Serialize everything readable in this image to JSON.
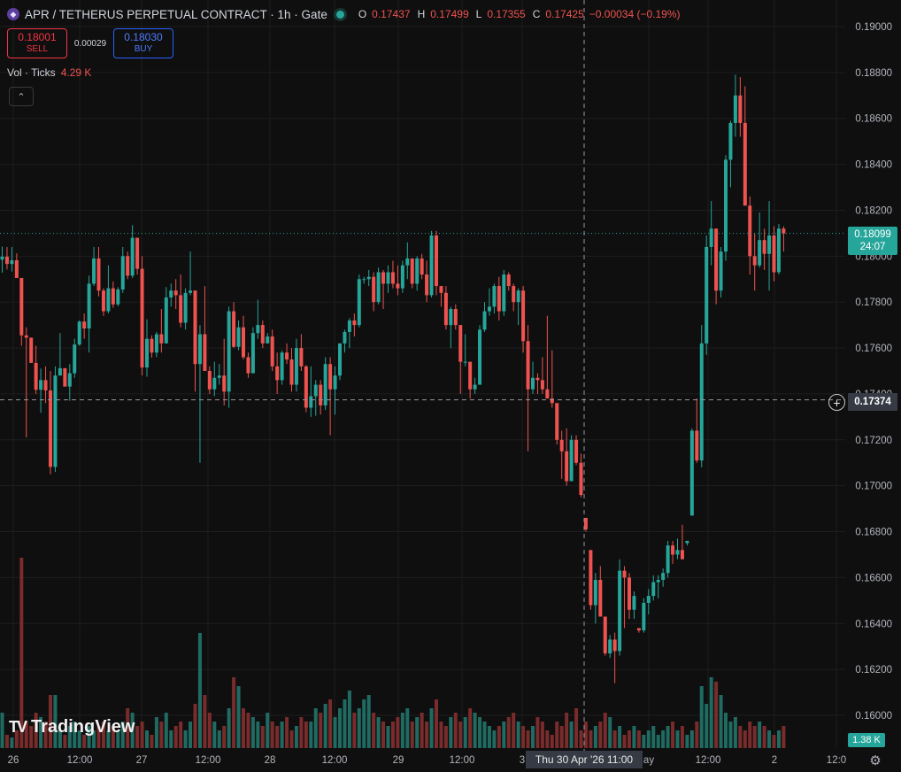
{
  "legend": {
    "symbol_icon": "crypto-symbol-icon",
    "title": "APR / TETHERUS PERPETUAL CONTRACT · 1h · Gate",
    "status_color": "#26a69a",
    "open_label": "O",
    "open": "0.17437",
    "high_label": "H",
    "high": "0.17499",
    "low_label": "L",
    "low": "0.17355",
    "close_label": "C",
    "close": "0.17425",
    "change": "−0.00034 (−0.19%)"
  },
  "trade": {
    "sell_price": "0.18001",
    "sell_label": "SELL",
    "spread": "0.00029",
    "buy_price": "0.18030",
    "buy_label": "BUY"
  },
  "volume_legend": {
    "label": "Vol · Ticks",
    "value": "4.29 K"
  },
  "collapse_icon": "chevron-up-icon",
  "logo": {
    "text": "TradingView",
    "mark": "TV"
  },
  "price_axis": {
    "ticks": [
      "0.19000",
      "0.18800",
      "0.18600",
      "0.18400",
      "0.18200",
      "0.18000",
      "0.17800",
      "0.17600",
      "0.17400",
      "0.17200",
      "0.17000",
      "0.16800",
      "0.16600",
      "0.16400",
      "0.16200",
      "0.16000"
    ]
  },
  "time_axis": {
    "ticks": [
      "26",
      "12:00",
      "27",
      "12:00",
      "28",
      "12:00",
      "29",
      "12:00",
      "3",
      "ay",
      "12:00",
      "2",
      "12:0"
    ]
  },
  "last_price": {
    "value": "0.18099",
    "countdown": "24:07",
    "color": "#26a69a"
  },
  "crosshair": {
    "price": "0.17374",
    "time": "Thu 30 Apr '26   11:00"
  },
  "volume_tag": "1.38 K",
  "colors": {
    "up": "#26a69a",
    "down": "#ef5350"
  },
  "chart_data": {
    "type": "candlestick",
    "title": "APR / TETHERUS PERPETUAL CONTRACT · 1h · Gate",
    "ylim": [
      0.159,
      0.1905
    ],
    "volume_series_name": "Vol · Ticks",
    "candles": [
      [
        0.17985,
        0.18042,
        0.17928,
        0.17998
      ],
      [
        0.17998,
        0.1804,
        0.17942,
        0.17966
      ],
      [
        0.17966,
        0.1804,
        0.17933,
        0.17982
      ],
      [
        0.17982,
        0.18012,
        0.17925,
        0.17905
      ],
      [
        0.17905,
        0.17905,
        0.1761,
        0.17655
      ],
      [
        0.17655,
        0.1769,
        0.1721,
        0.17645
      ],
      [
        0.17645,
        0.17645,
        0.17535,
        0.17535
      ],
      [
        0.17535,
        0.1761,
        0.174,
        0.17418
      ],
      [
        0.17418,
        0.1751,
        0.17318,
        0.1746
      ],
      [
        0.1746,
        0.1752,
        0.1736,
        0.17415
      ],
      [
        0.17415,
        0.175,
        0.1705,
        0.17082
      ],
      [
        0.17082,
        0.1752,
        0.1706,
        0.1748
      ],
      [
        0.1748,
        0.17665,
        0.1748,
        0.17512
      ],
      [
        0.17512,
        0.17512,
        0.17432,
        0.17432
      ],
      [
        0.17432,
        0.1753,
        0.1737,
        0.1749
      ],
      [
        0.1749,
        0.1764,
        0.1747,
        0.17615
      ],
      [
        0.17615,
        0.1772,
        0.1761,
        0.17715
      ],
      [
        0.17715,
        0.1775,
        0.1764,
        0.17685
      ],
      [
        0.17685,
        0.17915,
        0.1758,
        0.1788
      ],
      [
        0.1788,
        0.1804,
        0.1787,
        0.1799
      ],
      [
        0.1799,
        0.1804,
        0.17825,
        0.1785
      ],
      [
        0.1785,
        0.1786,
        0.1774,
        0.1776
      ],
      [
        0.1776,
        0.1796,
        0.1775,
        0.1786
      ],
      [
        0.1786,
        0.1789,
        0.17775,
        0.1779
      ],
      [
        0.1779,
        0.17865,
        0.17782,
        0.17855
      ],
      [
        0.17855,
        0.1804,
        0.1784,
        0.18
      ],
      [
        0.18,
        0.1802,
        0.179,
        0.17915
      ],
      [
        0.17915,
        0.18135,
        0.17905,
        0.1808
      ],
      [
        0.1808,
        0.1808,
        0.1792,
        0.17945
      ],
      [
        0.17945,
        0.18,
        0.1748,
        0.17515
      ],
      [
        0.17515,
        0.17725,
        0.17475,
        0.1764
      ],
      [
        0.1764,
        0.17655,
        0.17558,
        0.1758
      ],
      [
        0.1758,
        0.1767,
        0.1756,
        0.1766
      ],
      [
        0.1766,
        0.1777,
        0.1758,
        0.1762
      ],
      [
        0.1762,
        0.17865,
        0.1762,
        0.1782
      ],
      [
        0.1782,
        0.1788,
        0.1778,
        0.1785
      ],
      [
        0.1785,
        0.179,
        0.1777,
        0.1783
      ],
      [
        0.1783,
        0.1792,
        0.1769,
        0.1771
      ],
      [
        0.1771,
        0.1786,
        0.1768,
        0.1784
      ],
      [
        0.1784,
        0.1802,
        0.1783,
        0.1785
      ],
      [
        0.1785,
        0.1785,
        0.1741,
        0.1753
      ],
      [
        0.1753,
        0.177,
        0.171,
        0.1766
      ],
      [
        0.1766,
        0.1787,
        0.1762,
        0.175
      ],
      [
        0.175,
        0.1752,
        0.174,
        0.1742
      ],
      [
        0.1742,
        0.1754,
        0.1739,
        0.1747
      ],
      [
        0.1747,
        0.1753,
        0.1744,
        0.1748
      ],
      [
        0.1748,
        0.1764,
        0.1735,
        0.1741
      ],
      [
        0.1741,
        0.1778,
        0.1734,
        0.1776
      ],
      [
        0.1776,
        0.178,
        0.176,
        0.17605
      ],
      [
        0.17605,
        0.1772,
        0.1759,
        0.1769
      ],
      [
        0.1769,
        0.1774,
        0.1755,
        0.1756
      ],
      [
        0.1756,
        0.1758,
        0.1747,
        0.1749
      ],
      [
        0.1749,
        0.1769,
        0.1749,
        0.17665
      ],
      [
        0.17665,
        0.1781,
        0.1764,
        0.177
      ],
      [
        0.177,
        0.1772,
        0.176,
        0.1762
      ],
      [
        0.1762,
        0.17665,
        0.1762,
        0.1765
      ],
      [
        0.1765,
        0.1768,
        0.175,
        0.1752
      ],
      [
        0.1752,
        0.1758,
        0.174,
        0.1746
      ],
      [
        0.1746,
        0.1759,
        0.1744,
        0.1758
      ],
      [
        0.1758,
        0.1762,
        0.1753,
        0.1755
      ],
      [
        0.1755,
        0.176,
        0.1741,
        0.1744
      ],
      [
        0.1744,
        0.1764,
        0.1741,
        0.176
      ],
      [
        0.176,
        0.1766,
        0.175,
        0.1752
      ],
      [
        0.1752,
        0.17525,
        0.1732,
        0.1734
      ],
      [
        0.1734,
        0.1752,
        0.173,
        0.1739
      ],
      [
        0.1739,
        0.1746,
        0.17305,
        0.1744
      ],
      [
        0.1744,
        0.1746,
        0.1731,
        0.1735
      ],
      [
        0.1735,
        0.1756,
        0.1733,
        0.1753
      ],
      [
        0.1753,
        0.1756,
        0.1722,
        0.1742
      ],
      [
        0.1742,
        0.1752,
        0.1731,
        0.1748
      ],
      [
        0.1748,
        0.1762,
        0.1746,
        0.1762
      ],
      [
        0.1762,
        0.1768,
        0.1758,
        0.1767
      ],
      [
        0.1767,
        0.1773,
        0.176,
        0.1772
      ],
      [
        0.1772,
        0.1775,
        0.1765,
        0.177
      ],
      [
        0.177,
        0.1792,
        0.1769,
        0.179
      ],
      [
        0.179,
        0.1791,
        0.1788,
        0.179
      ],
      [
        0.179,
        0.1794,
        0.1787,
        0.1791
      ],
      [
        0.1791,
        0.1793,
        0.1776,
        0.178
      ],
      [
        0.178,
        0.1795,
        0.1779,
        0.1793
      ],
      [
        0.1793,
        0.1794,
        0.1777,
        0.1788
      ],
      [
        0.1788,
        0.1796,
        0.1784,
        0.1793
      ],
      [
        0.1793,
        0.1798,
        0.1786,
        0.1788
      ],
      [
        0.1788,
        0.1796,
        0.1783,
        0.1786
      ],
      [
        0.1786,
        0.1798,
        0.1784,
        0.1796
      ],
      [
        0.1796,
        0.1806,
        0.179,
        0.1799
      ],
      [
        0.1799,
        0.1799,
        0.1786,
        0.1788
      ],
      [
        0.1788,
        0.18,
        0.1785,
        0.1799
      ],
      [
        0.1799,
        0.1801,
        0.179,
        0.1792
      ],
      [
        0.1792,
        0.1798,
        0.178,
        0.1783
      ],
      [
        0.1783,
        0.1811,
        0.1782,
        0.1809
      ],
      [
        0.1809,
        0.1811,
        0.1783,
        0.1787
      ],
      [
        0.1787,
        0.1787,
        0.1778,
        0.1784
      ],
      [
        0.1784,
        0.1787,
        0.1768,
        0.177
      ],
      [
        0.177,
        0.1778,
        0.176,
        0.1777
      ],
      [
        0.1777,
        0.1779,
        0.1768,
        0.177
      ],
      [
        0.177,
        0.177,
        0.174,
        0.1754
      ],
      [
        0.1754,
        0.1766,
        0.1752,
        0.1754
      ],
      [
        0.1754,
        0.1754,
        0.1738,
        0.1742
      ],
      [
        0.1742,
        0.1747,
        0.174,
        0.1744
      ],
      [
        0.1744,
        0.177,
        0.1744,
        0.1768
      ],
      [
        0.1768,
        0.178,
        0.1767,
        0.1776
      ],
      [
        0.1776,
        0.1786,
        0.1774,
        0.1778
      ],
      [
        0.1778,
        0.1788,
        0.1775,
        0.1787
      ],
      [
        0.1787,
        0.1791,
        0.1772,
        0.1776
      ],
      [
        0.1776,
        0.1794,
        0.1774,
        0.1792
      ],
      [
        0.1792,
        0.1793,
        0.1785,
        0.1787
      ],
      [
        0.1787,
        0.1788,
        0.1776,
        0.178
      ],
      [
        0.178,
        0.1786,
        0.177,
        0.1785
      ],
      [
        0.1785,
        0.1787,
        0.1758,
        0.1763
      ],
      [
        0.1763,
        0.177,
        0.1715,
        0.1742
      ],
      [
        0.1742,
        0.1754,
        0.174,
        0.1747
      ],
      [
        0.1747,
        0.1749,
        0.174,
        0.1746
      ],
      [
        0.1746,
        0.1756,
        0.174,
        0.1742
      ],
      [
        0.1742,
        0.1774,
        0.1739,
        0.1738
      ],
      [
        0.1738,
        0.1759,
        0.1734,
        0.1736
      ],
      [
        0.1736,
        0.1736,
        0.1718,
        0.172
      ],
      [
        0.172,
        0.1724,
        0.1703,
        0.1715
      ],
      [
        0.1715,
        0.1725,
        0.17,
        0.1702
      ],
      [
        0.1702,
        0.1722,
        0.1702,
        0.172
      ],
      [
        0.172,
        0.1722,
        0.1709,
        0.171
      ],
      [
        0.171,
        0.1714,
        0.1695,
        0.1696
      ],
      [
        0.1686,
        0.1686,
        0.168,
        0.1681
      ],
      [
        0.1672,
        0.1672,
        0.1646,
        0.1648
      ],
      [
        0.1648,
        0.1662,
        0.164,
        0.1659
      ],
      [
        0.1659,
        0.1665,
        0.1644,
        0.1643
      ],
      [
        0.1643,
        0.1642,
        0.1626,
        0.1627
      ],
      [
        0.1627,
        0.1635,
        0.1625,
        0.1633
      ],
      [
        0.1633,
        0.1636,
        0.1614,
        0.1628
      ],
      [
        0.1628,
        0.1668,
        0.1626,
        0.1663
      ],
      [
        0.1663,
        0.1665,
        0.1638,
        0.166
      ],
      [
        0.166,
        0.1662,
        0.1642,
        0.1646
      ],
      [
        0.1646,
        0.1654,
        0.1642,
        0.1652
      ],
      [
        0.1638,
        0.1638,
        0.1636,
        0.1637
      ],
      [
        0.1637,
        0.1651,
        0.1636,
        0.1649
      ],
      [
        0.1649,
        0.1655,
        0.1644,
        0.1652
      ],
      [
        0.1652,
        0.1661,
        0.165,
        0.1658
      ],
      [
        0.1658,
        0.1661,
        0.1651,
        0.1659
      ],
      [
        0.1659,
        0.1664,
        0.1656,
        0.1662
      ],
      [
        0.1662,
        0.1676,
        0.166,
        0.1674
      ],
      [
        0.1674,
        0.1676,
        0.1666,
        0.167
      ],
      [
        0.167,
        0.1677,
        0.1668,
        0.1672
      ],
      [
        0.1672,
        0.1683,
        0.1668,
        0.1668
      ],
      [
        0.1675,
        0.1676,
        0.1674,
        0.1676
      ],
      [
        0.1687,
        0.1725,
        0.1687,
        0.1724
      ],
      [
        0.1724,
        0.1738,
        0.171,
        0.1711
      ],
      [
        0.1711,
        0.177,
        0.1708,
        0.1762
      ],
      [
        0.1762,
        0.1809,
        0.1757,
        0.1804
      ],
      [
        0.1804,
        0.1824,
        0.1796,
        0.1812
      ],
      [
        0.1812,
        0.1812,
        0.1779,
        0.1785
      ],
      [
        0.1785,
        0.1804,
        0.1782,
        0.1802
      ],
      [
        0.1802,
        0.1844,
        0.1798,
        0.1842
      ],
      [
        0.1842,
        0.1859,
        0.183,
        0.1858
      ],
      [
        0.1858,
        0.1879,
        0.1852,
        0.187
      ],
      [
        0.187,
        0.1878,
        0.1852,
        0.1858
      ],
      [
        0.1858,
        0.1874,
        0.1835,
        0.1822
      ],
      [
        0.1822,
        0.1826,
        0.1792,
        0.18
      ],
      [
        0.18,
        0.181,
        0.1785,
        0.1796
      ],
      [
        0.1796,
        0.1819,
        0.1795,
        0.1807
      ],
      [
        0.1807,
        0.1812,
        0.1794,
        0.1801
      ],
      [
        0.1801,
        0.1824,
        0.1785,
        0.1809
      ],
      [
        0.1809,
        0.1813,
        0.1789,
        0.1793
      ],
      [
        0.1793,
        0.1814,
        0.1792,
        0.1812
      ],
      [
        0.1812,
        0.1813,
        0.1802,
        0.18099
      ]
    ],
    "volumes": [
      40,
      15,
      12,
      20,
      215,
      30,
      25,
      40,
      35,
      30,
      60,
      60,
      20,
      15,
      25,
      30,
      20,
      15,
      25,
      20,
      25,
      30,
      20,
      25,
      20,
      30,
      45,
      40,
      25,
      30,
      20,
      15,
      35,
      30,
      40,
      20,
      25,
      30,
      20,
      30,
      50,
      130,
      60,
      40,
      30,
      20,
      25,
      45,
      80,
      70,
      45,
      40,
      35,
      30,
      25,
      40,
      30,
      25,
      30,
      35,
      20,
      25,
      35,
      30,
      30,
      45,
      40,
      50,
      55,
      35,
      45,
      55,
      65,
      40,
      45,
      55,
      60,
      40,
      35,
      30,
      25,
      30,
      35,
      40,
      45,
      30,
      35,
      40,
      30,
      45,
      55,
      30,
      25,
      35,
      40,
      30,
      35,
      45,
      40,
      35,
      30,
      25,
      20,
      25,
      30,
      35,
      40,
      30,
      25,
      20,
      25,
      35,
      30,
      20,
      15,
      30,
      25,
      40,
      30,
      45,
      20,
      30,
      20,
      25,
      30,
      40,
      35,
      20,
      25,
      15,
      20,
      25,
      20,
      15,
      20,
      25,
      15,
      20,
      25,
      30,
      20,
      25,
      15,
      20,
      30,
      70,
      50,
      80,
      75,
      60,
      40,
      30,
      35,
      25,
      20,
      30,
      25,
      30,
      25,
      20,
      15,
      20,
      25,
      30,
      15,
      20
    ]
  }
}
